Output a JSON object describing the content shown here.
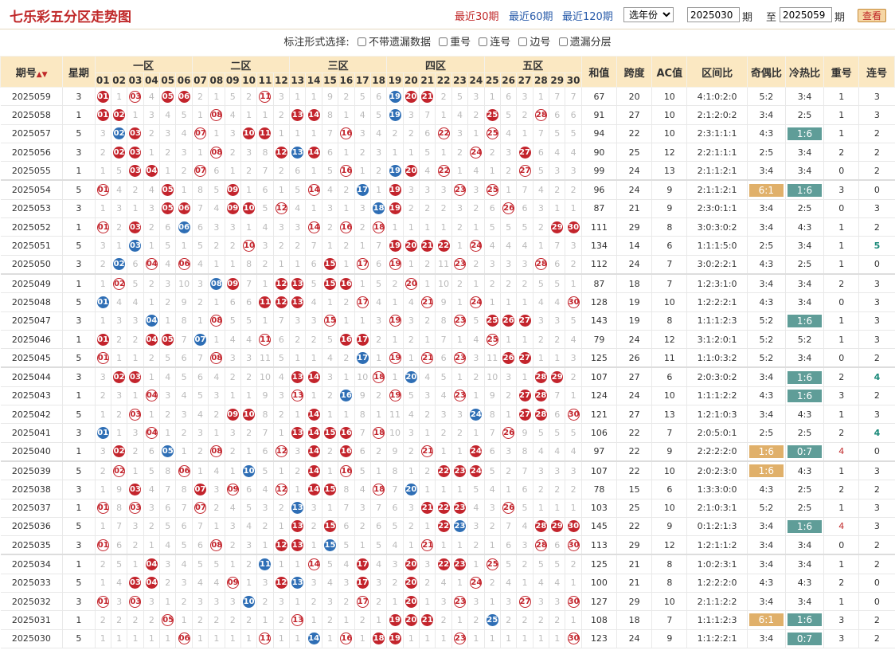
{
  "header": {
    "title": "七乐彩五分区走势图",
    "ranges": [
      "最近30期",
      "最近60期",
      "最近120期"
    ],
    "active_range": 0,
    "year_select": "选年份",
    "from_issue": "2025030",
    "from_label": "期",
    "to_prefix": "至",
    "to_issue": "2025059",
    "to_label": "期",
    "query_btn": "查看"
  },
  "options": {
    "label": "标注形式选择:",
    "items": [
      "不带遗漏数据",
      "重号",
      "连号",
      "边号",
      "遗漏分层"
    ]
  },
  "table": {
    "col_issue": "期号",
    "col_week": "星期",
    "zones": [
      "一区",
      "二区",
      "三区",
      "四区",
      "五区"
    ],
    "col_sum": "和值",
    "col_span": "跨度",
    "col_ac": "AC值",
    "col_zone_ratio": "区间比",
    "col_odd_even": "奇偶比",
    "col_hot_cold": "冷热比",
    "col_repeat": "重号",
    "col_consec": "连号",
    "rows": [
      {
        "issue": "2025059",
        "week": "3",
        "zone_nums": [
          [
            1,
            3,
            5,
            6
          ],
          [
            11
          ],
          [],
          [
            19,
            20,
            21
          ],
          []
        ],
        "sp": [
          19
        ],
        "sum": "67",
        "span": "20",
        "ac": "10",
        "zr": "4:1:0:2:0",
        "oe": "5:2",
        "hc": "3:4",
        "rep": "1",
        "con": "3"
      },
      {
        "issue": "2025058",
        "week": "1",
        "zone_nums": [
          [
            1,
            2
          ],
          [
            8
          ],
          [
            13,
            14
          ],
          [
            19
          ],
          [
            25,
            28
          ]
        ],
        "sp": [
          19
        ],
        "sum": "91",
        "span": "27",
        "ac": "10",
        "zr": "2:1:2:0:2",
        "oe": "3:4",
        "hc": "2:5",
        "rep": "1",
        "con": "3"
      },
      {
        "issue": "2025057",
        "week": "5",
        "zone_nums": [
          [
            2,
            3
          ],
          [
            7,
            10,
            11
          ],
          [
            16
          ],
          [
            22
          ],
          [
            25
          ]
        ],
        "sp": [
          2
        ],
        "sum": "94",
        "span": "22",
        "ac": "10",
        "zr": "2:3:1:1:1",
        "oe": "4:3",
        "hc": "1:6",
        "hc_hl": "tl",
        "rep": "1",
        "con": "2"
      },
      {
        "issue": "2025056",
        "week": "3",
        "zone_nums": [
          [
            2,
            3
          ],
          [
            8,
            12
          ],
          [
            13,
            14
          ],
          [
            24
          ],
          [
            27
          ]
        ],
        "sp": [
          13
        ],
        "sum": "90",
        "span": "25",
        "ac": "12",
        "zr": "2:2:1:1:1",
        "oe": "2:5",
        "hc": "3:4",
        "rep": "2",
        "con": "2"
      },
      {
        "issue": "2025055",
        "week": "1",
        "zone_nums": [
          [
            3,
            4
          ],
          [
            7
          ],
          [
            16
          ],
          [
            19,
            20,
            22
          ],
          [
            27
          ]
        ],
        "sp": [
          19
        ],
        "sum": "99",
        "span": "24",
        "ac": "13",
        "zr": "2:1:1:2:1",
        "oe": "3:4",
        "hc": "3:4",
        "rep": "0",
        "con": "2"
      },
      {
        "issue": "2025054",
        "week": "5",
        "zone_nums": [
          [
            1,
            5
          ],
          [
            9
          ],
          [
            14,
            17
          ],
          [
            19,
            23
          ],
          [
            25
          ]
        ],
        "sp": [
          17
        ],
        "sum": "96",
        "span": "24",
        "ac": "9",
        "zr": "2:1:1:2:1",
        "oe": "6:1",
        "oe_hl": "or",
        "hc": "1:6",
        "hc_hl": "tl",
        "rep": "3",
        "con": "0"
      },
      {
        "issue": "2025053",
        "week": "3",
        "zone_nums": [
          [
            5,
            6
          ],
          [
            9,
            10,
            12
          ],
          [
            18
          ],
          [
            19
          ],
          [
            26
          ]
        ],
        "sp": [
          18
        ],
        "sum": "87",
        "span": "21",
        "ac": "9",
        "zr": "2:3:0:1:1",
        "oe": "3:4",
        "hc": "2:5",
        "rep": "0",
        "con": "3"
      },
      {
        "issue": "2025052",
        "week": "1",
        "zone_nums": [
          [
            1,
            3,
            6
          ],
          [],
          [
            14,
            16,
            18
          ],
          [],
          [
            29,
            30
          ]
        ],
        "sp": [
          6
        ],
        "sum": "111",
        "span": "29",
        "ac": "8",
        "zr": "3:0:3:0:2",
        "oe": "3:4",
        "hc": "4:3",
        "rep": "1",
        "con": "2"
      },
      {
        "issue": "2025051",
        "week": "5",
        "zone_nums": [
          [
            3
          ],
          [
            10
          ],
          [],
          [
            19,
            20,
            21,
            22,
            24
          ],
          []
        ],
        "sp": [
          3
        ],
        "sum": "134",
        "span": "14",
        "ac": "6",
        "zr": "1:1:1:5:0",
        "oe": "2:5",
        "hc": "3:4",
        "rep": "1",
        "con": "5",
        "con_hl": true
      },
      {
        "issue": "2025050",
        "week": "3",
        "zone_nums": [
          [
            2,
            4,
            6
          ],
          [],
          [
            15,
            17
          ],
          [
            19,
            23
          ],
          [
            28
          ]
        ],
        "sp": [
          2
        ],
        "sum": "112",
        "span": "24",
        "ac": "7",
        "zr": "3:0:2:2:1",
        "oe": "4:3",
        "hc": "2:5",
        "rep": "1",
        "con": "0"
      },
      {
        "issue": "2025049",
        "week": "1",
        "zone_nums": [
          [
            2
          ],
          [
            8,
            9,
            12
          ],
          [
            13,
            15,
            16
          ],
          [
            20
          ],
          []
        ],
        "sp": [
          8
        ],
        "sum": "87",
        "span": "18",
        "ac": "7",
        "zr": "1:2:3:1:0",
        "oe": "3:4",
        "hc": "3:4",
        "rep": "2",
        "con": "3"
      },
      {
        "issue": "2025048",
        "week": "5",
        "zone_nums": [
          [
            1
          ],
          [
            11,
            12
          ],
          [
            13,
            17
          ],
          [
            21,
            24
          ],
          [
            30
          ]
        ],
        "sp": [
          1
        ],
        "sum": "128",
        "span": "19",
        "ac": "10",
        "zr": "1:2:2:2:1",
        "oe": "4:3",
        "hc": "3:4",
        "rep": "0",
        "con": "3"
      },
      {
        "issue": "2025047",
        "week": "3",
        "zone_nums": [
          [
            4
          ],
          [
            8
          ],
          [
            15
          ],
          [
            19,
            23
          ],
          [
            25,
            26,
            27
          ]
        ],
        "sp": [
          4
        ],
        "sum": "143",
        "span": "19",
        "ac": "8",
        "zr": "1:1:1:2:3",
        "oe": "5:2",
        "hc": "1:6",
        "hc_hl": "tl",
        "rep": "1",
        "con": "3"
      },
      {
        "issue": "2025046",
        "week": "1",
        "zone_nums": [
          [
            1,
            4,
            5
          ],
          [
            7,
            11
          ],
          [
            16,
            17
          ],
          [],
          [
            25
          ]
        ],
        "sp": [
          7
        ],
        "sum": "79",
        "span": "24",
        "ac": "12",
        "zr": "3:1:2:0:1",
        "oe": "5:2",
        "hc": "5:2",
        "rep": "1",
        "con": "3"
      },
      {
        "issue": "2025045",
        "week": "5",
        "zone_nums": [
          [
            1
          ],
          [
            8
          ],
          [
            17
          ],
          [
            19,
            21,
            23
          ],
          [
            26,
            27
          ]
        ],
        "sp": [
          17
        ],
        "sum": "125",
        "span": "26",
        "ac": "11",
        "zr": "1:1:0:3:2",
        "oe": "5:2",
        "hc": "3:4",
        "rep": "0",
        "con": "2"
      },
      {
        "issue": "2025044",
        "week": "3",
        "zone_nums": [
          [
            2,
            3
          ],
          [],
          [
            13,
            14,
            18
          ],
          [
            20
          ],
          [
            28,
            29
          ]
        ],
        "sp": [
          20
        ],
        "sum": "107",
        "span": "27",
        "ac": "6",
        "zr": "2:0:3:0:2",
        "oe": "3:4",
        "hc": "1:6",
        "hc_hl": "tl",
        "rep": "2",
        "con": "4",
        "con_hl": true
      },
      {
        "issue": "2025043",
        "week": "1",
        "zone_nums": [
          [
            4
          ],
          [],
          [
            13,
            16
          ],
          [
            19,
            23
          ],
          [
            27,
            28
          ]
        ],
        "sp": [
          16
        ],
        "sum": "124",
        "span": "24",
        "ac": "10",
        "zr": "1:1:1:2:2",
        "oe": "4:3",
        "hc": "1:6",
        "hc_hl": "tl",
        "rep": "3",
        "con": "2"
      },
      {
        "issue": "2025042",
        "week": "5",
        "zone_nums": [
          [
            3
          ],
          [
            9,
            10
          ],
          [
            14
          ],
          [
            24
          ],
          [
            27,
            28,
            30
          ]
        ],
        "sp": [
          24
        ],
        "sum": "121",
        "span": "27",
        "ac": "13",
        "zr": "1:2:1:0:3",
        "oe": "3:4",
        "hc": "4:3",
        "rep": "1",
        "con": "3"
      },
      {
        "issue": "2025041",
        "week": "3",
        "zone_nums": [
          [
            1,
            4
          ],
          [],
          [
            13,
            14,
            15,
            16,
            18
          ],
          [],
          [
            26
          ]
        ],
        "sp": [
          1
        ],
        "sum": "106",
        "span": "22",
        "ac": "7",
        "zr": "2:0:5:0:1",
        "oe": "2:5",
        "hc": "2:5",
        "rep": "2",
        "con": "4",
        "con_hl": true
      },
      {
        "issue": "2025040",
        "week": "1",
        "zone_nums": [
          [
            2,
            5
          ],
          [
            8,
            12
          ],
          [
            14,
            16
          ],
          [
            21,
            24
          ],
          []
        ],
        "sp": [
          5
        ],
        "sum": "97",
        "span": "22",
        "ac": "9",
        "zr": "2:2:2:2:0",
        "oe": "1:6",
        "oe_hl": "or",
        "hc": "0:7",
        "hc_hl": "tl",
        "rep": "4",
        "rep_hl": true,
        "con": "0"
      },
      {
        "issue": "2025039",
        "week": "5",
        "zone_nums": [
          [
            2,
            6
          ],
          [
            10
          ],
          [
            14,
            16
          ],
          [
            22,
            23,
            24
          ],
          []
        ],
        "sp": [
          10
        ],
        "sum": "107",
        "span": "22",
        "ac": "10",
        "zr": "2:0:2:3:0",
        "oe": "1:6",
        "oe_hl": "or",
        "hc": "4:3",
        "rep": "1",
        "con": "3"
      },
      {
        "issue": "2025038",
        "week": "3",
        "zone_nums": [
          [
            3
          ],
          [
            7,
            9,
            12
          ],
          [
            14,
            15,
            18
          ],
          [
            20
          ],
          []
        ],
        "sp": [
          20
        ],
        "sum": "78",
        "span": "15",
        "ac": "6",
        "zr": "1:3:3:0:0",
        "oe": "4:3",
        "hc": "2:5",
        "rep": "2",
        "con": "2"
      },
      {
        "issue": "2025037",
        "week": "1",
        "zone_nums": [
          [
            1,
            3
          ],
          [
            7
          ],
          [
            13
          ],
          [
            21,
            22,
            23
          ],
          [
            26
          ]
        ],
        "sp": [
          13
        ],
        "sum": "103",
        "span": "25",
        "ac": "10",
        "zr": "2:1:0:3:1",
        "oe": "5:2",
        "hc": "2:5",
        "rep": "1",
        "con": "3"
      },
      {
        "issue": "2025036",
        "week": "5",
        "zone_nums": [
          [],
          [],
          [
            13,
            15
          ],
          [
            22,
            23
          ],
          [
            28,
            29,
            30
          ]
        ],
        "sp": [
          23
        ],
        "sum": "145",
        "span": "22",
        "ac": "9",
        "zr": "0:1:2:1:3",
        "oe": "3:4",
        "hc": "1:6",
        "hc_hl": "tl",
        "rep": "4",
        "rep_hl": true,
        "con": "3"
      },
      {
        "issue": "2025035",
        "week": "3",
        "zone_nums": [
          [
            1
          ],
          [
            8,
            12
          ],
          [
            13,
            15
          ],
          [
            21
          ],
          [
            28,
            30
          ]
        ],
        "sp": [
          15
        ],
        "sum": "113",
        "span": "29",
        "ac": "12",
        "zr": "1:2:1:1:2",
        "oe": "3:4",
        "hc": "3:4",
        "rep": "0",
        "con": "2"
      },
      {
        "issue": "2025034",
        "week": "1",
        "zone_nums": [
          [
            4
          ],
          [
            11
          ],
          [
            14,
            17
          ],
          [
            20,
            22,
            23
          ],
          [
            25
          ]
        ],
        "sp": [
          11
        ],
        "sum": "125",
        "span": "21",
        "ac": "8",
        "zr": "1:0:2:3:1",
        "oe": "3:4",
        "hc": "3:4",
        "rep": "1",
        "con": "2"
      },
      {
        "issue": "2025033",
        "week": "5",
        "zone_nums": [
          [
            3,
            4
          ],
          [
            9,
            12
          ],
          [
            13,
            17
          ],
          [
            20,
            24
          ],
          []
        ],
        "sp": [
          13
        ],
        "sum": "100",
        "span": "21",
        "ac": "8",
        "zr": "1:2:2:2:0",
        "oe": "4:3",
        "hc": "4:3",
        "rep": "2",
        "con": "0"
      },
      {
        "issue": "2025032",
        "week": "3",
        "zone_nums": [
          [
            1,
            3
          ],
          [
            10
          ],
          [
            17
          ],
          [
            20,
            23
          ],
          [
            27,
            30
          ]
        ],
        "sp": [
          10
        ],
        "sum": "127",
        "span": "29",
        "ac": "10",
        "zr": "2:1:1:2:2",
        "oe": "3:4",
        "hc": "3:4",
        "rep": "1",
        "con": "0"
      },
      {
        "issue": "2025031",
        "week": "1",
        "zone_nums": [
          [
            5
          ],
          [],
          [
            13
          ],
          [
            19,
            20,
            21
          ],
          [
            25
          ]
        ],
        "sp": [
          25
        ],
        "sum": "108",
        "span": "18",
        "ac": "7",
        "zr": "1:1:1:2:3",
        "oe": "6:1",
        "oe_hl": "or",
        "hc": "1:6",
        "hc_hl": "tl",
        "rep": "3",
        "con": "2"
      },
      {
        "issue": "2025030",
        "week": "5",
        "zone_nums": [
          [
            6
          ],
          [
            11
          ],
          [
            14,
            16,
            18
          ],
          [
            19,
            23
          ],
          [
            30
          ]
        ],
        "sp": [
          14
        ],
        "sum": "123",
        "span": "24",
        "ac": "9",
        "zr": "1:1:2:2:1",
        "oe": "3:4",
        "hc": "0:7",
        "hc_hl": "tl",
        "rep": "3",
        "con": "2"
      }
    ]
  }
}
